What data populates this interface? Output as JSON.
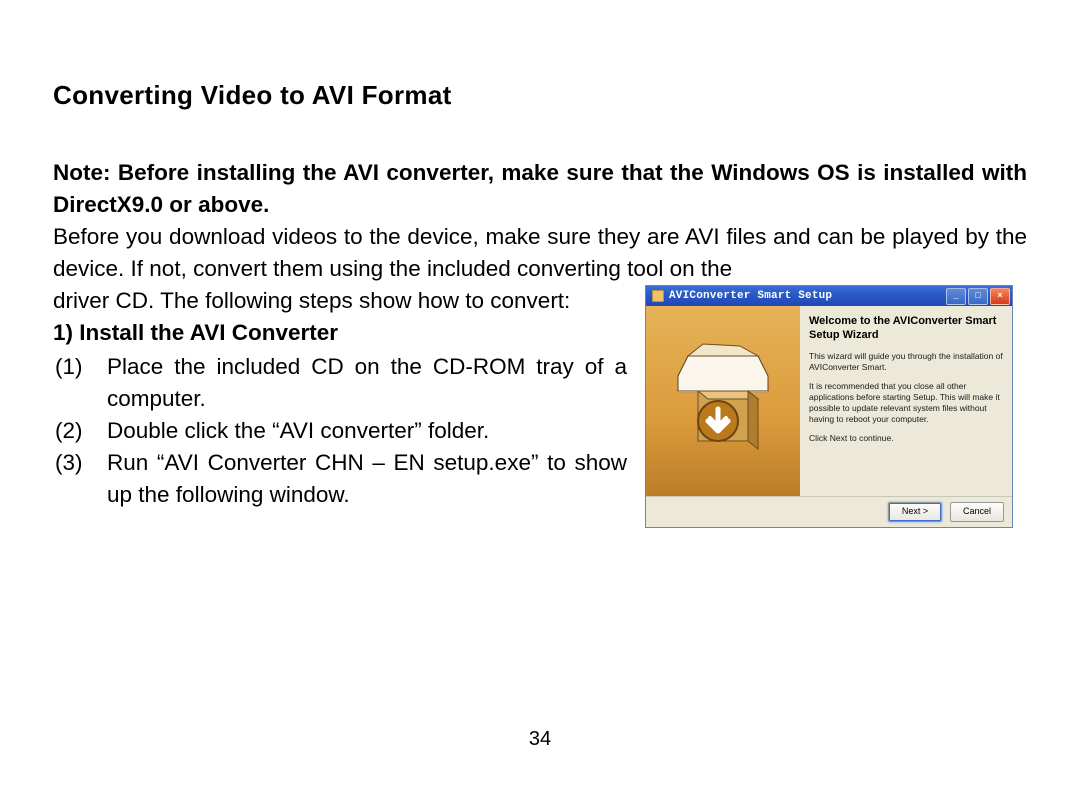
{
  "title": "Converting Video to AVI Format",
  "note": "Note: Before installing the AVI converter, make sure that the Windows OS is installed with DirectX9.0 or above.",
  "intro_main": "Before you download videos to the device, make sure they are AVI files and can be played by the device. If not, convert them using the included converting tool on the",
  "intro_tail": "driver CD. The following steps show how to convert:",
  "section_heading": "1) Install the AVI Converter",
  "steps": [
    {
      "n": "(1)",
      "t": "Place the included CD on the CD-ROM tray of a computer."
    },
    {
      "n": "(2)",
      "t": "Double click the “AVI converter” folder."
    },
    {
      "n": "(3)",
      "t": "Run “AVI Converter CHN – EN setup.exe” to show up the following window."
    }
  ],
  "wizard": {
    "titlebar": "AVIConverter Smart Setup",
    "heading": "Welcome to the AVIConverter Smart Setup Wizard",
    "p1": "This wizard will guide you through the installation of AVIConverter Smart.",
    "p2": "It is recommended that you close all other applications before starting Setup. This will make it possible to update relevant system files without having to reboot your computer.",
    "p3": "Click Next to continue.",
    "btn_next": "Next >",
    "btn_cancel": "Cancel",
    "min": "_",
    "max": "□",
    "close": "×"
  },
  "page_number": "34"
}
